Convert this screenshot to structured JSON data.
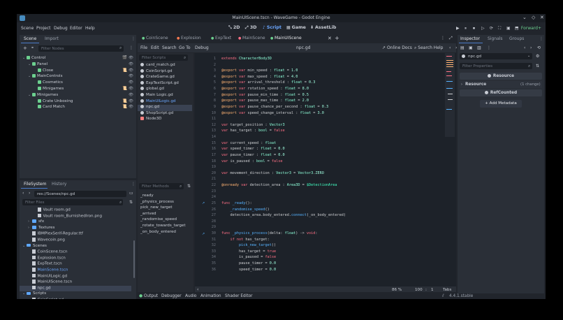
{
  "window": {
    "title": "MainUIScene.tscn - WaveGame - Godot Engine",
    "controls": [
      "⌄",
      "◇",
      "✕"
    ]
  },
  "menu": [
    "Scene",
    "Project",
    "Debug",
    "Editor",
    "Help"
  ],
  "workspaces": [
    {
      "label": "2D",
      "icon": "⤡",
      "active": false
    },
    {
      "label": "3D",
      "icon": "⤢",
      "active": false
    },
    {
      "label": "Script",
      "icon": "♪",
      "active": true
    },
    {
      "label": "Game",
      "icon": "▦",
      "active": false
    },
    {
      "label": "AssetLib",
      "icon": "⬇",
      "active": false
    }
  ],
  "play_controls": [
    "▶",
    "⏸",
    "⏹",
    "▷",
    "⟳",
    "⛶",
    "▣",
    "⬒"
  ],
  "renderer": "Forward+",
  "scene_dock": {
    "tabs": [
      "Scene",
      "Import"
    ],
    "filter_placeholder": "Filter Nodes",
    "tree": [
      {
        "label": "Control",
        "depth": 0,
        "color": "#6cd08f",
        "expanded": true,
        "icons": "🎬 👁"
      },
      {
        "label": "Panel",
        "depth": 1,
        "color": "#6cd08f",
        "expanded": true,
        "icons": "👁"
      },
      {
        "label": "Close",
        "depth": 2,
        "color": "#6cd08f",
        "expanded": false,
        "icons": "📜 👁"
      },
      {
        "label": "MainControls",
        "depth": 1,
        "color": "#6cd08f",
        "expanded": true,
        "icons": "👁"
      },
      {
        "label": "Cosmetics",
        "depth": 2,
        "color": "#6cd08f",
        "expanded": false,
        "icons": "👁"
      },
      {
        "label": "Minigames",
        "depth": 2,
        "color": "#6cd08f",
        "expanded": false,
        "icons": "📜 👁"
      },
      {
        "label": "Minigames",
        "depth": 1,
        "color": "#6cd08f",
        "expanded": true,
        "icons": "👁"
      },
      {
        "label": "Crate Unboxing",
        "depth": 2,
        "color": "#6cd08f",
        "expanded": false,
        "icons": "📜 👁"
      },
      {
        "label": "Card Match",
        "depth": 2,
        "color": "#6cd08f",
        "expanded": false,
        "icons": "📜 👁"
      }
    ]
  },
  "filesystem": {
    "tabs": [
      "FileSystem",
      "History"
    ],
    "path": "res://Scenes/npc.gd",
    "filter_placeholder": "Filter Files",
    "items": [
      {
        "label": "Vault room.gd",
        "depth": 2,
        "kind": "file"
      },
      {
        "label": "Vault room_BurnishedIron.png",
        "depth": 2,
        "kind": "file"
      },
      {
        "label": "sfx",
        "depth": 1,
        "kind": "folder",
        "collapsed": true
      },
      {
        "label": "Textures",
        "depth": 1,
        "kind": "folder",
        "collapsed": true
      },
      {
        "label": "IBMPlexSerif-Regular.ttf",
        "depth": 1,
        "kind": "file"
      },
      {
        "label": "Wavecoin.png",
        "depth": 1,
        "kind": "file"
      },
      {
        "label": "Scenes",
        "depth": 0,
        "kind": "folder",
        "collapsed": false
      },
      {
        "label": "CoinScene.tscn",
        "depth": 1,
        "kind": "file"
      },
      {
        "label": "Explosion.tscn",
        "depth": 1,
        "kind": "file"
      },
      {
        "label": "ExpText.tscn",
        "depth": 1,
        "kind": "file"
      },
      {
        "label": "MainScene.tscn",
        "depth": 1,
        "kind": "file",
        "highlight": true
      },
      {
        "label": "MainUILogic.gd",
        "depth": 1,
        "kind": "file"
      },
      {
        "label": "MainUIScene.tscn",
        "depth": 1,
        "kind": "file"
      },
      {
        "label": "npc.gd",
        "depth": 1,
        "kind": "file",
        "selected": true
      },
      {
        "label": "Scripts",
        "depth": 0,
        "kind": "folder",
        "collapsed": false
      },
      {
        "label": "CoinScript.gd",
        "depth": 1,
        "kind": "file"
      },
      {
        "label": "ExpTextScript.gd",
        "depth": 1,
        "kind": "file"
      }
    ]
  },
  "scene_tabs": [
    {
      "label": "CoinScene",
      "color": "#6cd08f"
    },
    {
      "label": "Explosion",
      "color": "#ff7b52"
    },
    {
      "label": "ExpText",
      "color": "#6cd08f"
    },
    {
      "label": "MainScene",
      "color": "#ff7085"
    },
    {
      "label": "MainUIScene",
      "color": "#6cd08f",
      "active": true
    }
  ],
  "script_menu": [
    "File",
    "Edit",
    "Search",
    "Go To",
    "Debug"
  ],
  "script_file": "npc.gd",
  "script_actions": {
    "docs": "Online Docs",
    "help": "Search Help"
  },
  "script_list": {
    "filter_placeholder": "Filter Scripts",
    "items": [
      {
        "label": "card_match.gd",
        "selected": false
      },
      {
        "label": "CoinScript.gd",
        "selected": false
      },
      {
        "label": "CrateGame.gd",
        "selected": false
      },
      {
        "label": "ExpTextScript.gd",
        "selected": false
      },
      {
        "label": "global.gd",
        "selected": false
      },
      {
        "label": "Main Logic.gd",
        "selected": false
      },
      {
        "label": "MainUILogic.gd",
        "selected": false,
        "highlight": true
      },
      {
        "label": "npc.gd",
        "selected": true
      },
      {
        "label": "ShopScript.gd",
        "selected": false
      },
      {
        "label": "Node3D",
        "selected": false
      }
    ]
  },
  "methods": {
    "filter_placeholder": "Filter Methods",
    "items": [
      "_ready",
      "_physics_process",
      "pick_new_target",
      "_arrived",
      "_randomise_speed",
      "_rotate_towards_target",
      "_on_body_entered"
    ]
  },
  "code": [
    {
      "n": "1",
      "t": [
        [
          "kw",
          "extends "
        ],
        [
          "ty",
          "CharacterBody3D"
        ]
      ]
    },
    {
      "n": "2",
      "t": []
    },
    {
      "n": "3",
      "t": [
        [
          "an",
          "@export "
        ],
        [
          "kw",
          "var "
        ],
        [
          "pl",
          "min_speed : "
        ],
        [
          "ty",
          "float"
        ],
        [
          "pl",
          " = "
        ],
        [
          "nu",
          "1.0"
        ]
      ]
    },
    {
      "n": "4",
      "t": [
        [
          "an",
          "@export "
        ],
        [
          "kw",
          "var "
        ],
        [
          "pl",
          "max_speed : "
        ],
        [
          "ty",
          "float"
        ],
        [
          "pl",
          " = "
        ],
        [
          "nu",
          "4.0"
        ]
      ]
    },
    {
      "n": "5",
      "t": [
        [
          "an",
          "@export "
        ],
        [
          "kw",
          "var "
        ],
        [
          "pl",
          "arrival_threshold : "
        ],
        [
          "ty",
          "float"
        ],
        [
          "pl",
          " = "
        ],
        [
          "nu",
          "0.3"
        ]
      ]
    },
    {
      "n": "6",
      "t": [
        [
          "an",
          "@export "
        ],
        [
          "kw",
          "var "
        ],
        [
          "pl",
          "rotation_speed : "
        ],
        [
          "ty",
          "float"
        ],
        [
          "pl",
          " = "
        ],
        [
          "nu",
          "8.0"
        ]
      ]
    },
    {
      "n": "7",
      "t": [
        [
          "an",
          "@export "
        ],
        [
          "kw",
          "var "
        ],
        [
          "pl",
          "pause_min_time : "
        ],
        [
          "ty",
          "float"
        ],
        [
          "pl",
          " = "
        ],
        [
          "nu",
          "0.5"
        ]
      ]
    },
    {
      "n": "8",
      "t": [
        [
          "an",
          "@export "
        ],
        [
          "kw",
          "var "
        ],
        [
          "pl",
          "pause_max_time : "
        ],
        [
          "ty",
          "float"
        ],
        [
          "pl",
          " = "
        ],
        [
          "nu",
          "2.0"
        ]
      ]
    },
    {
      "n": "9",
      "t": [
        [
          "an",
          "@export "
        ],
        [
          "kw",
          "var "
        ],
        [
          "pl",
          "pause_chance_per_second : "
        ],
        [
          "ty",
          "float"
        ],
        [
          "pl",
          " = "
        ],
        [
          "nu",
          "0.3"
        ]
      ]
    },
    {
      "n": "10",
      "t": [
        [
          "an",
          "@export "
        ],
        [
          "kw",
          "var "
        ],
        [
          "pl",
          "speed_change_interval : "
        ],
        [
          "ty",
          "float"
        ],
        [
          "pl",
          " = "
        ],
        [
          "nu",
          "3.0"
        ]
      ]
    },
    {
      "n": "11",
      "t": []
    },
    {
      "n": "12",
      "t": [
        [
          "kw",
          "var "
        ],
        [
          "pl",
          "target_position : "
        ],
        [
          "ty",
          "Vector3"
        ]
      ]
    },
    {
      "n": "13",
      "t": [
        [
          "kw",
          "var "
        ],
        [
          "pl",
          "has_target : "
        ],
        [
          "ty",
          "bool"
        ],
        [
          "pl",
          " = "
        ],
        [
          "kw",
          "false"
        ]
      ]
    },
    {
      "n": "14",
      "t": []
    },
    {
      "n": "15",
      "t": [
        [
          "kw",
          "var "
        ],
        [
          "pl",
          "current_speed : "
        ],
        [
          "ty",
          "float"
        ]
      ]
    },
    {
      "n": "16",
      "t": [
        [
          "kw",
          "var "
        ],
        [
          "pl",
          "speed_timer : "
        ],
        [
          "ty",
          "float"
        ],
        [
          "pl",
          " = "
        ],
        [
          "nu",
          "0.0"
        ]
      ]
    },
    {
      "n": "17",
      "t": [
        [
          "kw",
          "var "
        ],
        [
          "pl",
          "pause_timer : "
        ],
        [
          "ty",
          "float"
        ],
        [
          "pl",
          " = "
        ],
        [
          "nu",
          "0.0"
        ]
      ]
    },
    {
      "n": "18",
      "t": [
        [
          "kw",
          "var "
        ],
        [
          "pl",
          "is_paused : "
        ],
        [
          "ty",
          "bool"
        ],
        [
          "pl",
          " = "
        ],
        [
          "kw",
          "false"
        ]
      ]
    },
    {
      "n": "19",
      "t": []
    },
    {
      "n": "20",
      "t": [
        [
          "kw",
          "var "
        ],
        [
          "pl",
          "movement_direction : "
        ],
        [
          "ty",
          "Vector3"
        ],
        [
          "pl",
          " = "
        ],
        [
          "ty",
          "Vector3"
        ],
        [
          "pl",
          "."
        ],
        [
          "nm",
          "ZERO"
        ]
      ]
    },
    {
      "n": "21",
      "t": []
    },
    {
      "n": "22",
      "t": [
        [
          "an",
          "@onready "
        ],
        [
          "kw",
          "var "
        ],
        [
          "pl",
          "detection_area : "
        ],
        [
          "ty",
          "Area3D"
        ],
        [
          "pl",
          " = "
        ],
        [
          "cl",
          "$DetectionArea"
        ]
      ]
    },
    {
      "n": "23",
      "t": []
    },
    {
      "n": "24",
      "t": []
    },
    {
      "n": "25",
      "t": [
        [
          "kw",
          "func "
        ],
        [
          "fn",
          "_ready"
        ],
        [
          "pl",
          "():"
        ]
      ]
    },
    {
      "n": "26",
      "t": [
        [
          "pl",
          "    "
        ],
        [
          "fn",
          "_randomise_speed"
        ],
        [
          "pl",
          "()"
        ]
      ]
    },
    {
      "n": "27",
      "t": [
        [
          "pl",
          "    detection_area.body_entered."
        ],
        [
          "fn",
          "connect"
        ],
        [
          "pl",
          "(_on_body_entered)"
        ]
      ]
    },
    {
      "n": "28",
      "t": []
    },
    {
      "n": "29",
      "t": []
    },
    {
      "n": "30",
      "t": [
        [
          "kw",
          "func "
        ],
        [
          "fn",
          "_physics_process"
        ],
        [
          "pl",
          "(delta: "
        ],
        [
          "ty",
          "float"
        ],
        [
          "pl",
          ") -> "
        ],
        [
          "kw",
          "void"
        ],
        [
          "pl",
          ":"
        ]
      ]
    },
    {
      "n": "31",
      "t": [
        [
          "pl",
          "    "
        ],
        [
          "kw",
          "if not "
        ],
        [
          "pl",
          "has_target:"
        ]
      ]
    },
    {
      "n": "32",
      "t": [
        [
          "pl",
          "        "
        ],
        [
          "fn",
          "pick_new_target"
        ],
        [
          "pl",
          "()"
        ]
      ]
    },
    {
      "n": "33",
      "t": [
        [
          "pl",
          "        has_target = "
        ],
        [
          "kw",
          "true"
        ]
      ]
    },
    {
      "n": "34",
      "t": [
        [
          "pl",
          "        is_paused = "
        ],
        [
          "kw",
          "false"
        ]
      ]
    },
    {
      "n": "35",
      "t": [
        [
          "pl",
          "        pause_timer = "
        ],
        [
          "nu",
          "0.0"
        ]
      ]
    },
    {
      "n": "36",
      "t": [
        [
          "pl",
          "        speed_timer = "
        ],
        [
          "nu",
          "0.0"
        ]
      ]
    }
  ],
  "status": {
    "zoom": "86 %",
    "line": "100",
    "col": "1",
    "indent": "Tabs"
  },
  "inspector": {
    "tabs": [
      "Inspector",
      "Signals",
      "Groups"
    ],
    "file": "npc.gd",
    "filter_placeholder": "Filter Properties",
    "resource_header": "Resource",
    "resource_section": "Resource",
    "changes": "(1 change)",
    "refcounted": "RefCounted",
    "add_metadata": "Add Metadata"
  },
  "bottom_tabs": [
    "Output",
    "Debugger",
    "Audio",
    "Animation",
    "Shader Editor"
  ],
  "version": "4.4.1.stable"
}
